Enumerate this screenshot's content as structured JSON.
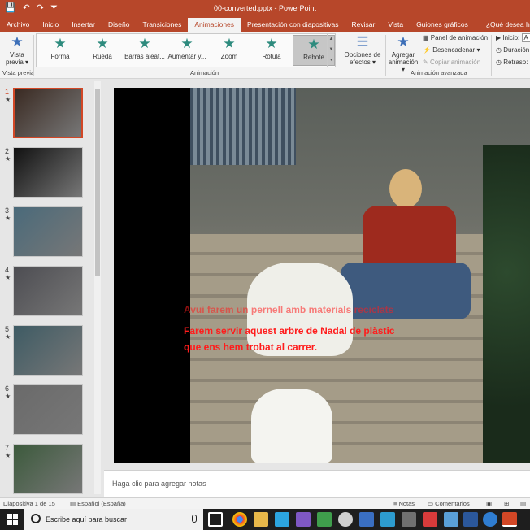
{
  "window": {
    "doc_title": "00-converted.pptx - PowerPoint"
  },
  "qat": {
    "save": "💾",
    "undo": "↶",
    "redo": "↷",
    "more": "⏷"
  },
  "tabs": [
    {
      "label": "Archivo",
      "active": false
    },
    {
      "label": "Inicio",
      "active": false
    },
    {
      "label": "Insertar",
      "active": false
    },
    {
      "label": "Diseño",
      "active": false
    },
    {
      "label": "Transiciones",
      "active": false
    },
    {
      "label": "Animaciones",
      "active": true
    },
    {
      "label": "Presentación con diapositivas",
      "active": false
    },
    {
      "label": "Revisar",
      "active": false
    },
    {
      "label": "Vista",
      "active": false
    },
    {
      "label": "Guiones gráficos",
      "active": false
    },
    {
      "label": "¿Qué desea hacer?",
      "active": false
    }
  ],
  "ribbon": {
    "preview": {
      "label1": "Vista",
      "label2": "previa ▾",
      "group": "Vista previa"
    },
    "gallery": [
      {
        "label": "Forma",
        "selected": false
      },
      {
        "label": "Rueda",
        "selected": false
      },
      {
        "label": "Barras aleat...",
        "selected": false
      },
      {
        "label": "Aumentar y...",
        "selected": false
      },
      {
        "label": "Zoom",
        "selected": false
      },
      {
        "label": "Rótula",
        "selected": false
      },
      {
        "label": "Rebote",
        "selected": true
      }
    ],
    "effect_options": {
      "label1": "Opciones de",
      "label2": "efectos ▾"
    },
    "animation_group": "Animación",
    "add_animation": {
      "label1": "Agregar",
      "label2": "animación ▾"
    },
    "animation_panel": "Panel de animación",
    "trigger": "Desencadenar ▾",
    "copy_animation": "Copiar animación",
    "advanced_group": "Animación avanzada",
    "timing": {
      "start": "Inicio:",
      "start_value": "A",
      "duration": "Duración",
      "delay": "Retraso:"
    }
  },
  "slides": [
    {
      "num": "1",
      "star": "★",
      "selected": true
    },
    {
      "num": "2",
      "star": "★",
      "selected": false
    },
    {
      "num": "3",
      "star": "★",
      "selected": false
    },
    {
      "num": "4",
      "star": "★",
      "selected": false
    },
    {
      "num": "5",
      "star": "★",
      "selected": false
    },
    {
      "num": "6",
      "star": "★",
      "selected": false
    },
    {
      "num": "7",
      "star": "★",
      "selected": false
    }
  ],
  "slide_text": {
    "line1": "Avui farem un pernell amb materials reciclats",
    "line2": "Farem servir aquest arbre de Nadal de plàstic",
    "line3": "que ens hem trobat al carrer."
  },
  "notes": {
    "placeholder": "Haga clic para agregar notas"
  },
  "status": {
    "slide_count": "Diapositiva 1 de 15",
    "language": "Español (España)",
    "notes": "Notas",
    "comments": "Comentarios"
  },
  "taskbar": {
    "search_placeholder": "Escribe aquí para buscar"
  }
}
